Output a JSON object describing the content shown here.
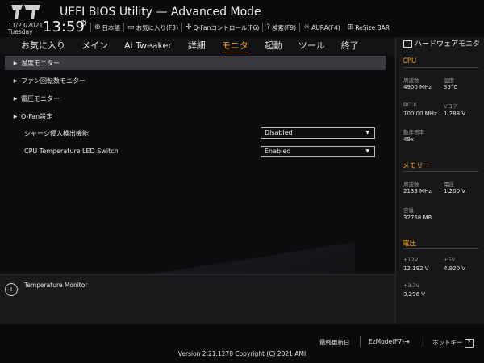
{
  "header": {
    "title": "UEFI BIOS Utility — Advanced Mode",
    "date": "11/23/2021",
    "day": "Tuesday",
    "time": "13:59",
    "toolbar": [
      {
        "icon": "globe-icon",
        "label": "日本語"
      },
      {
        "icon": "favorites-icon",
        "label": "お気に入り(F3)"
      },
      {
        "icon": "fan-icon",
        "label": "Q-Fanコントロール(F6)"
      },
      {
        "icon": "search-help-icon",
        "label": "検索(F9)"
      },
      {
        "icon": "aura-icon",
        "label": "AURA(F4)"
      },
      {
        "icon": "resize-bar-icon",
        "label": "ReSize BAR"
      }
    ]
  },
  "menu": {
    "items": [
      "お気に入り",
      "メイン",
      "Ai Tweaker",
      "詳細",
      "モニタ",
      "起動",
      "ツール",
      "終了"
    ],
    "active_index": 4
  },
  "main": {
    "submenus": [
      "温度モニター",
      "ファン回転数モニター",
      "電圧モニター",
      "Q-Fan設定"
    ],
    "settings": [
      {
        "label": "シャーシ侵入検出機能",
        "value": "Disabled"
      },
      {
        "label": "CPU Temperature LED Switch",
        "value": "Enabled"
      }
    ]
  },
  "help": {
    "text": "Temperature Monitor"
  },
  "hw": {
    "title": "ハードウェアモニター",
    "cpu": {
      "heading": "CPU",
      "freq_label": "周波数",
      "freq_value": "4900 MHz",
      "temp_label": "温度",
      "temp_value": "33°C",
      "bclk_label": "BCLK",
      "bclk_value": "100.00 MHz",
      "vcore_label": "Vコア",
      "vcore_value": "1.288 V",
      "ratio_label": "動作倍率",
      "ratio_value": "49x"
    },
    "memory": {
      "heading": "メモリー",
      "freq_label": "周波数",
      "freq_value": "2133 MHz",
      "volt_label": "電圧",
      "volt_value": "1.200 V",
      "cap_label": "容量",
      "cap_value": "32768 MB"
    },
    "voltage": {
      "heading": "電圧",
      "v12_label": "+12V",
      "v12_value": "12.192 V",
      "v5_label": "+5V",
      "v5_value": "4.920 V",
      "v33_label": "+3.3V",
      "v33_value": "3.296 V"
    }
  },
  "footer": {
    "last_modified": "最終更新日",
    "ezmode": "EzMode(F7)",
    "hotkeys": "ホットキー",
    "hotkeys_icon": "?",
    "copyright": "Version 2.21.1278 Copyright (C) 2021 AMI"
  },
  "colors": {
    "accent": "#f6a21c",
    "background": "#0d0d0f",
    "selected_row": "#3a3a3e"
  }
}
